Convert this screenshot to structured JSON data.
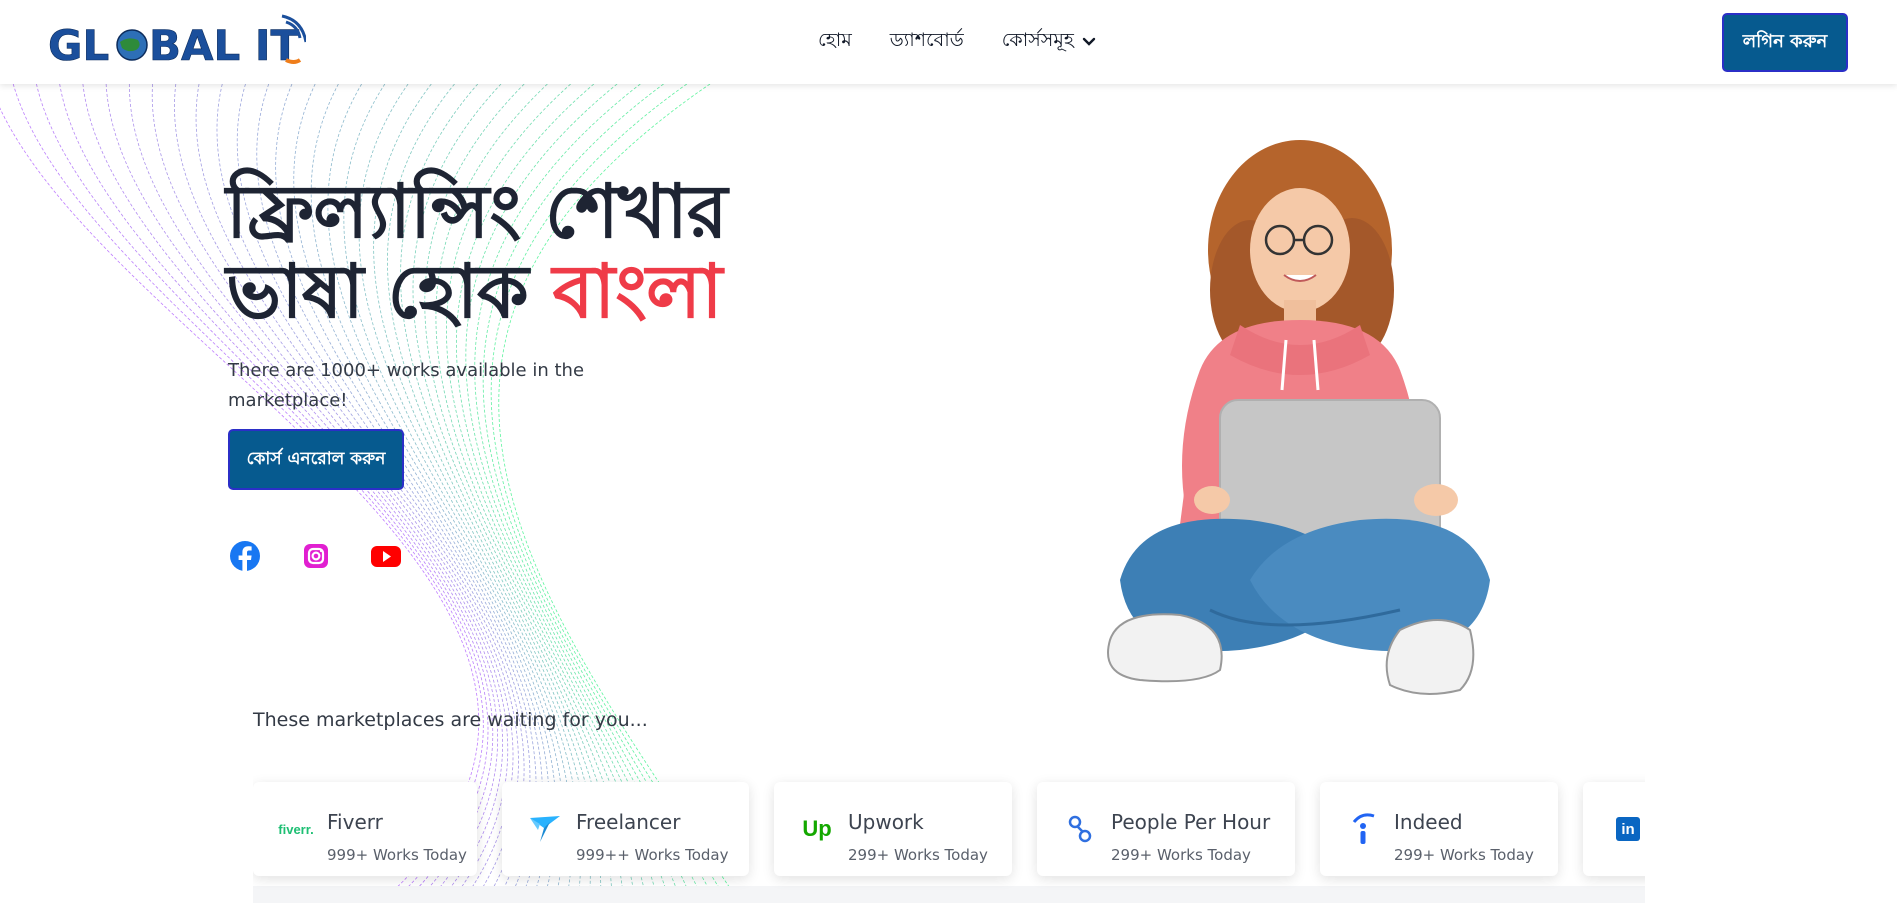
{
  "brand": {
    "logo_text": "GL BAL IT"
  },
  "nav": {
    "home": "হোম",
    "dashboard": "ড্যাশবোর্ড",
    "courses": "কোর্সসমূহ",
    "login": "লগিন করুন"
  },
  "hero": {
    "title_line1": "ফ্রিল্যান্সিং শেখার",
    "title_line2_a": "ভাষা হোক ",
    "title_line2_b": "বাংলা",
    "subtitle": "There are 1000+ works available in the marketplace!",
    "enroll_button": "কোর্স এনরোল করুন"
  },
  "social": [
    "facebook-icon",
    "instagram-icon",
    "youtube-icon"
  ],
  "marketplaces": {
    "heading": "These marketplaces are waiting for you...",
    "items": [
      {
        "name": "Fiverr",
        "sub": "999+ Works Today",
        "logo_text": "fiverr."
      },
      {
        "name": "Freelancer",
        "sub": "999++ Works Today"
      },
      {
        "name": "Upwork",
        "sub": "299+ Works Today",
        "logo_text": "Up"
      },
      {
        "name": "People Per Hour",
        "sub": "299+ Works Today"
      },
      {
        "name": "Indeed",
        "sub": "299+ Works Today",
        "logo_text": "i"
      },
      {
        "name": "",
        "sub": "",
        "logo_text": "in"
      }
    ]
  },
  "colors": {
    "primary": "#065a8f",
    "accent_red": "#ef3b48",
    "title_dark": "#1e2433"
  }
}
